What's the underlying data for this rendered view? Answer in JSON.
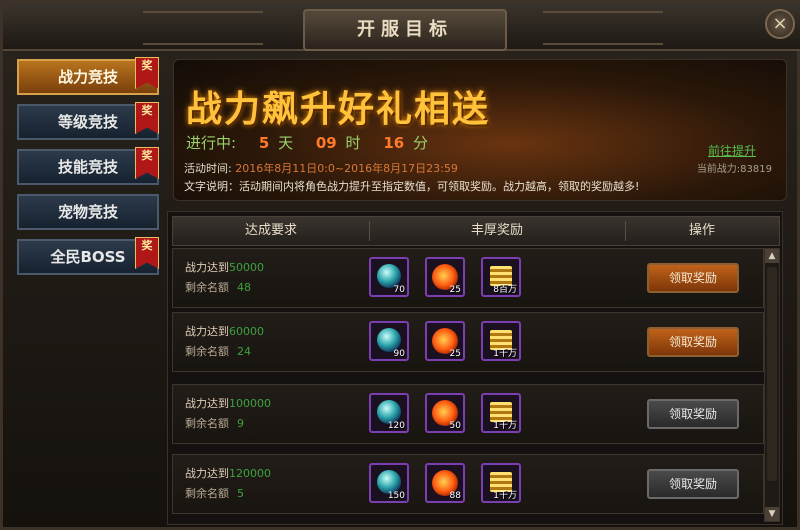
{
  "window": {
    "title": "开服目标",
    "close_icon": "×"
  },
  "sidebar": {
    "items": [
      {
        "label": "战力竞技",
        "badge": "奖",
        "active": true
      },
      {
        "label": "等级竞技",
        "badge": "奖",
        "active": false
      },
      {
        "label": "技能竞技",
        "badge": "奖",
        "active": false
      },
      {
        "label": "宠物竞技",
        "badge": "",
        "active": false
      },
      {
        "label": "全民BOSS",
        "badge": "奖",
        "active": false
      }
    ]
  },
  "banner": {
    "title": "战力飙升好礼相送",
    "countdown_label": "进行中:",
    "days": "5",
    "days_unit": "天",
    "hours": "09",
    "hours_unit": "时",
    "minutes": "16",
    "minutes_unit": "分",
    "time_label": "活动时间:",
    "time_value": "2016年8月11日0:0~2016年8月17日23:59",
    "desc": "文字说明：活动期间内将角色战力提升至指定数值，可领取奖励。战力越高，领取的奖励越多!",
    "goto_link": "前往提升",
    "power": "当前战力:83819"
  },
  "table": {
    "headers": [
      "达成要求",
      "丰厚奖励",
      "操作"
    ],
    "req_prefix": "战力达到",
    "remain_label": "剩余名额",
    "rows": [
      {
        "power": "50000",
        "remain": "48",
        "rewards": [
          {
            "icon": "orb-icon",
            "count": "70"
          },
          {
            "icon": "fire-icon",
            "count": "25"
          },
          {
            "icon": "gold-icon",
            "count": "8百万"
          }
        ],
        "button": "领取奖励",
        "enabled": true
      },
      {
        "power": "60000",
        "remain": "24",
        "rewards": [
          {
            "icon": "orb-icon",
            "count": "90"
          },
          {
            "icon": "fire-icon",
            "count": "25"
          },
          {
            "icon": "gold-icon",
            "count": "1千万"
          }
        ],
        "button": "领取奖励",
        "enabled": true
      },
      {
        "power": "100000",
        "remain": "9",
        "rewards": [
          {
            "icon": "orb-icon",
            "count": "120"
          },
          {
            "icon": "fire-icon",
            "count": "50"
          },
          {
            "icon": "gold-icon",
            "count": "1千万"
          }
        ],
        "button": "领取奖励",
        "enabled": false
      },
      {
        "power": "120000",
        "remain": "5",
        "rewards": [
          {
            "icon": "orb-icon",
            "count": "150"
          },
          {
            "icon": "fire-icon",
            "count": "88"
          },
          {
            "icon": "gold-icon",
            "count": "1千万"
          }
        ],
        "button": "领取奖励",
        "enabled": false
      }
    ]
  },
  "colors": {
    "accent": "#ffc23a",
    "active_tab": "#b8741e",
    "green_value": "#3ca23c",
    "button_on": "#c0621a"
  }
}
